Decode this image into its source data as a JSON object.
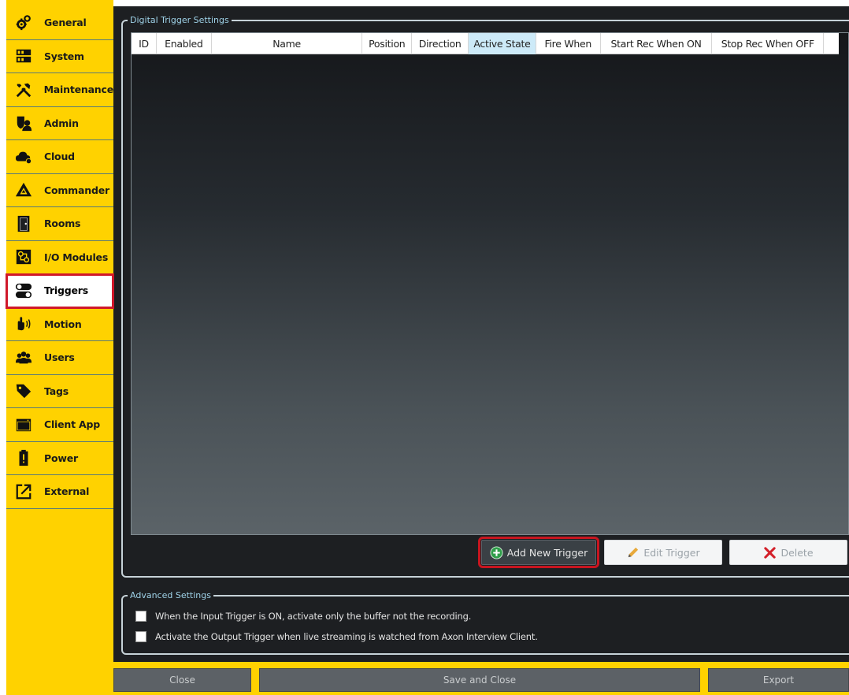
{
  "sidebar": {
    "items": [
      {
        "label": "General",
        "icon": "gears-icon"
      },
      {
        "label": "System",
        "icon": "server-icon"
      },
      {
        "label": "Maintenance",
        "icon": "tools-icon"
      },
      {
        "label": "Admin",
        "icon": "admin-shield-icon"
      },
      {
        "label": "Cloud",
        "icon": "cloud-icon"
      },
      {
        "label": "Commander",
        "icon": "commander-icon"
      },
      {
        "label": "Rooms",
        "icon": "door-icon"
      },
      {
        "label": "I/O Modules",
        "icon": "io-module-icon"
      },
      {
        "label": "Triggers",
        "icon": "toggle-switches-icon"
      },
      {
        "label": "Motion",
        "icon": "motion-hand-icon"
      },
      {
        "label": "Users",
        "icon": "users-icon"
      },
      {
        "label": "Tags",
        "icon": "tag-icon"
      },
      {
        "label": "Client App",
        "icon": "window-icon"
      },
      {
        "label": "Power",
        "icon": "battery-icon"
      },
      {
        "label": "External",
        "icon": "external-link-icon"
      }
    ],
    "selected": "Triggers"
  },
  "trigger_settings": {
    "title": "Digital Trigger Settings",
    "columns": [
      "ID",
      "Enabled",
      "Name",
      "Position",
      "Direction",
      "Active State",
      "Fire When",
      "Start Rec When ON",
      "Stop Rec When OFF"
    ],
    "active_column": "Active State",
    "rows": [],
    "buttons": {
      "add": "Add New Trigger",
      "edit": "Edit Trigger",
      "delete": "Delete"
    }
  },
  "advanced_settings": {
    "title": "Advanced Settings",
    "options": [
      {
        "label": "When the Input Trigger is ON, activate only the buffer not the recording.",
        "checked": false
      },
      {
        "label": "Activate the Output Trigger when live streaming is watched from Axon Interview Client.",
        "checked": false
      }
    ]
  },
  "footer": {
    "close": "Close",
    "save_close": "Save and Close",
    "export": "Export"
  },
  "colors": {
    "sidebar_bg": "#ffd200",
    "panel_bg": "#1d1f22",
    "highlight_red": "#c8151f",
    "group_title": "#9fd2e8"
  }
}
